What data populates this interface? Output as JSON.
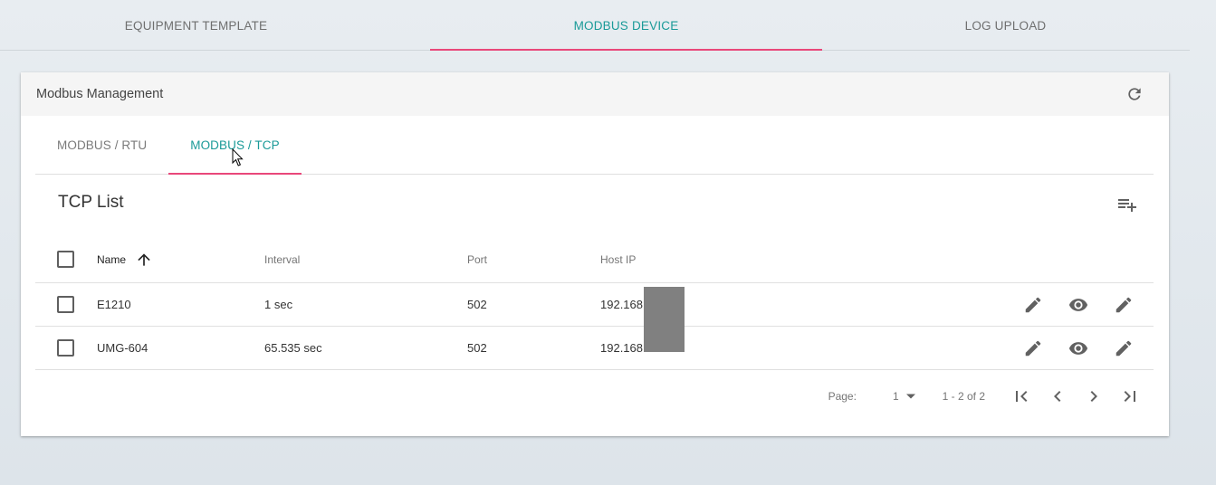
{
  "top_tabs": [
    {
      "label": "EQUIPMENT TEMPLATE"
    },
    {
      "label": "MODBUS DEVICE"
    },
    {
      "label": "LOG UPLOAD"
    }
  ],
  "card": {
    "title": "Modbus Management",
    "refresh_icon": "refresh-icon"
  },
  "sub_tabs": [
    {
      "label": "MODBUS / RTU"
    },
    {
      "label": "MODBUS / TCP"
    }
  ],
  "list": {
    "title": "TCP List",
    "add_icon": "playlist-add-icon"
  },
  "table": {
    "headers": {
      "name": "Name",
      "interval": "Interval",
      "port": "Port",
      "host": "Host IP"
    },
    "sort_icon": "arrow-up-icon",
    "rows": [
      {
        "name": "E1210",
        "interval": "1 sec",
        "port": "502",
        "host": "192.168"
      },
      {
        "name": "UMG-604",
        "interval": "65.535 sec",
        "port": "502",
        "host": "192.168"
      }
    ]
  },
  "pager": {
    "page_label": "Page:",
    "page_value": "1",
    "range": "1 - 2 of 2"
  },
  "colors": {
    "accent_teal": "#1a9a98",
    "accent_pink": "#e9477a",
    "icon_gray": "#616161"
  }
}
